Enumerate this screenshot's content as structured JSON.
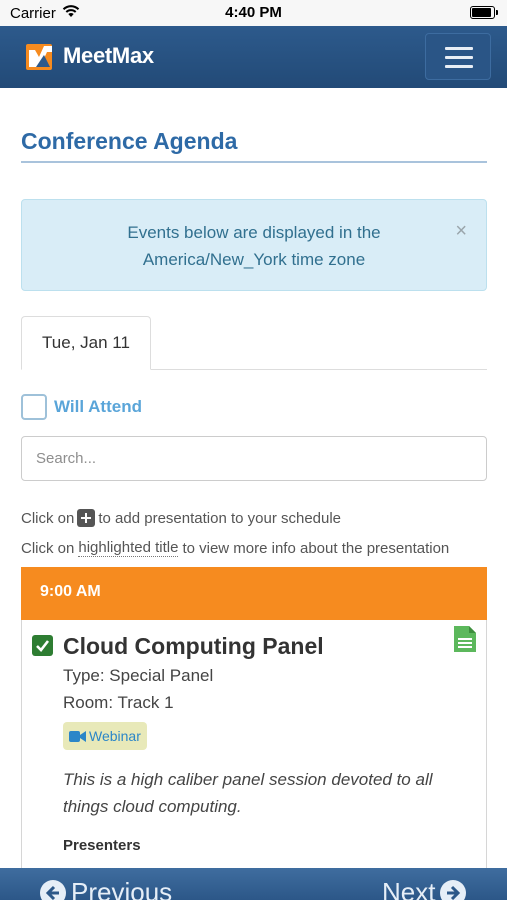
{
  "status_bar": {
    "carrier": "Carrier",
    "time": "4:40 PM",
    "wifi_icon": "wifi-icon",
    "battery_icon": "battery-icon"
  },
  "navbar": {
    "brand": "MeetMax",
    "logo_icon": "meetmax-logo",
    "menu_icon": "hamburger-icon",
    "brand_color": "#2d5a8c"
  },
  "page": {
    "title": "Conference Agenda"
  },
  "alert": {
    "line1": "Events below are displayed in the",
    "line2": "America/New_York time zone",
    "close": "×",
    "bg_color": "#d9edf7"
  },
  "tabs": [
    {
      "label": "Tue, Jan 11",
      "active": true
    }
  ],
  "filter": {
    "will_attend_label": "Will Attend",
    "checked": false
  },
  "search": {
    "placeholder": "Search...",
    "value": ""
  },
  "hints": {
    "line1_prefix": "Click on",
    "line1_suffix": "to add presentation to your schedule",
    "line2_prefix": "Click on",
    "line2_highlight": "highlighted title",
    "line2_suffix": "to view more info about the presentation"
  },
  "sessions": [
    {
      "time": "9:00 AM",
      "time_color": "#f68b1f",
      "title": "Cloud Computing Panel",
      "type": "Type: Special Panel",
      "room": "Room: Track 1",
      "badge": "Webinar",
      "badge_icon": "video-camera-icon",
      "doc_icon": "document-icon",
      "added": true,
      "description": "This is a high caliber panel session devoted to all things cloud computing.",
      "presenters_label": "Presenters"
    }
  ],
  "pager": {
    "previous": "Previous",
    "next": "Next"
  }
}
